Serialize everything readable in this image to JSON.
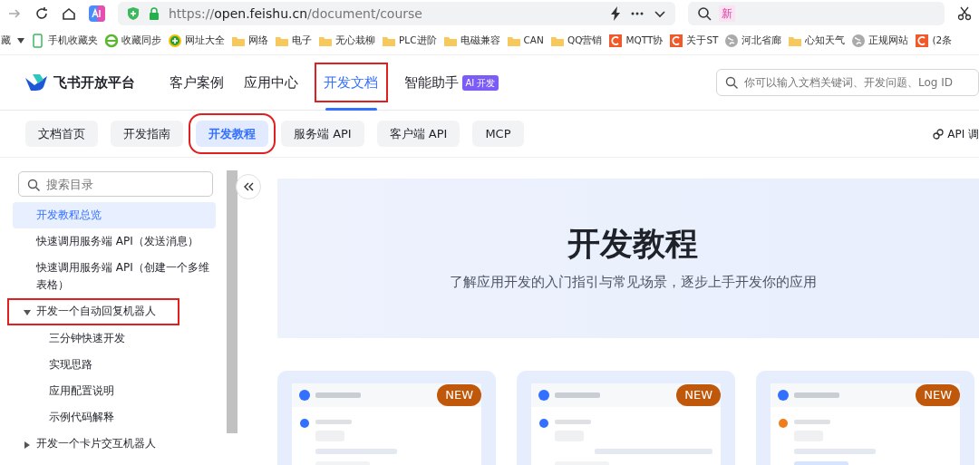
{
  "browser": {
    "scheme": "https://",
    "host": "open.feishu.cn",
    "path": "/document/course",
    "search_badge": "新"
  },
  "bookmarks": [
    {
      "label": "藏",
      "kind": "text"
    },
    {
      "label": "手机收藏夹",
      "kind": "phone"
    },
    {
      "label": "收藏同步",
      "kind": "sync"
    },
    {
      "label": "网址大全",
      "kind": "plus"
    },
    {
      "label": "网络",
      "kind": "folder"
    },
    {
      "label": "电子",
      "kind": "folder"
    },
    {
      "label": "无心栽柳",
      "kind": "folder"
    },
    {
      "label": "PLC进阶",
      "kind": "folder"
    },
    {
      "label": "电磁兼容",
      "kind": "folder"
    },
    {
      "label": "CAN",
      "kind": "folder"
    },
    {
      "label": "QQ营销",
      "kind": "folder"
    },
    {
      "label": "MQTT协",
      "kind": "c"
    },
    {
      "label": "关于ST",
      "kind": "c"
    },
    {
      "label": "河北省廊",
      "kind": "globe"
    },
    {
      "label": "心知天气",
      "kind": "folder"
    },
    {
      "label": "正规网站",
      "kind": "globe"
    },
    {
      "label": "(2条",
      "kind": "c"
    }
  ],
  "header": {
    "brand": "飞书开放平台",
    "nav": [
      {
        "label": "客户案例",
        "selected": false,
        "annotated": false
      },
      {
        "label": "应用中心",
        "selected": false,
        "annotated": false
      },
      {
        "label": "开发文档",
        "selected": true,
        "annotated": true
      },
      {
        "label": "智能助手",
        "selected": false,
        "annotated": false,
        "badge": "AI 开发"
      }
    ],
    "search": {
      "placeholder": "你可以输入文档关键词、开发问题、Log ID"
    }
  },
  "tabs": [
    {
      "label": "文档首页",
      "selected": false,
      "annotated": false
    },
    {
      "label": "开发指南",
      "selected": false,
      "annotated": false
    },
    {
      "label": "开发教程",
      "selected": true,
      "annotated": true
    },
    {
      "label": "服务端 API",
      "selected": false,
      "annotated": false
    },
    {
      "label": "客户端 API",
      "selected": false,
      "annotated": false
    },
    {
      "label": "MCP",
      "selected": false,
      "annotated": false
    }
  ],
  "api_debug": "API 调",
  "sidebar": {
    "search": {
      "placeholder": "搜索目录"
    },
    "items": [
      {
        "label": "开发教程总览",
        "selected": true
      },
      {
        "label": "快速调用服务端 API（发送消息）",
        "selected": false
      },
      {
        "label": "快速调用服务端 API（创建一个多维表格）",
        "selected": false
      },
      {
        "label": "开发一个自动回复机器人",
        "selected": false,
        "annotated": true,
        "expanded": true,
        "children": [
          {
            "label": "三分钟快速开发",
            "selected": false
          },
          {
            "label": "实现思路",
            "selected": false
          },
          {
            "label": "应用配置说明",
            "selected": false
          },
          {
            "label": "示例代码解释",
            "selected": false
          }
        ]
      },
      {
        "label": "开发一个卡片交互机器人",
        "selected": false,
        "expanded": false
      }
    ]
  },
  "hero": {
    "title": "开发教程",
    "subtitle": "了解应用开发的入门指引与常见场景，逐步上手开发你的应用"
  },
  "cards": [
    {
      "badge": "NEW",
      "kind": "picture"
    },
    {
      "badge": "NEW",
      "kind": "picture"
    },
    {
      "badge": "NEW",
      "kind": "picture"
    }
  ]
}
